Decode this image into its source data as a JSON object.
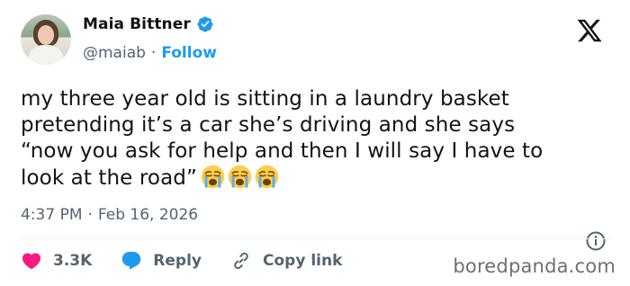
{
  "author": {
    "name": "Maia Bittner",
    "handle": "@maiab",
    "separator": "·",
    "follow_label": "Follow"
  },
  "tweet": {
    "text": "my three year old is sitting in a laundry basket\npretending it’s a car she’s driving and she says\n“now you ask for help and then I will say I have to\nlook at the road”",
    "emojis": [
      "loudly-crying-face",
      "loudly-crying-face",
      "loudly-crying-face"
    ]
  },
  "meta": {
    "time": "4:37 PM",
    "separator": "·",
    "date": "Feb 16, 2026"
  },
  "actions": {
    "like_count": "3.3K",
    "reply_label": "Reply",
    "copy_link_label": "Copy link"
  },
  "watermark": "boredpanda.com",
  "colors": {
    "accent": "#1d9bf0",
    "like": "#f91880",
    "text_primary": "#0f1419",
    "text_secondary": "#536471"
  }
}
